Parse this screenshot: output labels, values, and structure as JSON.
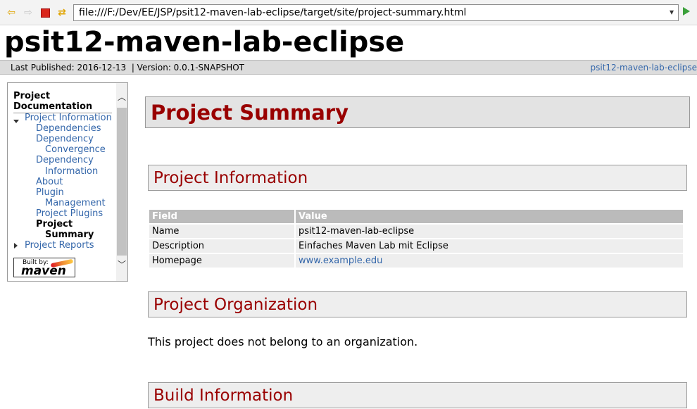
{
  "browser": {
    "url": "file:///F:/Dev/EE/JSP/psit12-maven-lab-eclipse/target/site/project-summary.html",
    "icons": [
      "back-arrow-icon",
      "forward-arrow-icon",
      "stop-icon",
      "refresh-icon",
      "dropdown-icon",
      "go-icon"
    ]
  },
  "site": {
    "title": "psit12-maven-lab-eclipse",
    "last_published": "Last Published: 2016-12-13",
    "version": "| Version: 0.0.1-SNAPSHOT",
    "breadcrumb_link": "psit12-maven-lab-eclipse"
  },
  "nav": {
    "heading": "Project Documentation",
    "items": [
      {
        "label": "Project Information"
      },
      {
        "label": "Dependencies"
      },
      {
        "label": "Dependency"
      },
      {
        "label": "Convergence"
      },
      {
        "label": "Dependency"
      },
      {
        "label": "Information"
      },
      {
        "label": "About"
      },
      {
        "label": "Plugin"
      },
      {
        "label": "Management"
      },
      {
        "label": "Project Plugins"
      },
      {
        "label": "Project"
      },
      {
        "label": "Summary"
      },
      {
        "label": "Project Reports"
      }
    ],
    "built_by": "Built by:",
    "maven": "maven"
  },
  "main": {
    "page_title": "Project Summary",
    "sections": {
      "info": "Project Information",
      "org": "Project Organization",
      "build": "Build Information"
    },
    "table": {
      "headers": [
        "Field",
        "Value"
      ],
      "rows": [
        [
          "Name",
          "psit12-maven-lab-eclipse"
        ],
        [
          "Description",
          "Einfaches Maven Lab mit Eclipse"
        ],
        [
          "Homepage",
          "www.example.edu"
        ]
      ]
    },
    "org_text": "This project does not belong to an organization."
  },
  "colors": {
    "heading_red": "#990000",
    "link_blue": "#3366aa",
    "header_gray": "#bbbbbb"
  }
}
